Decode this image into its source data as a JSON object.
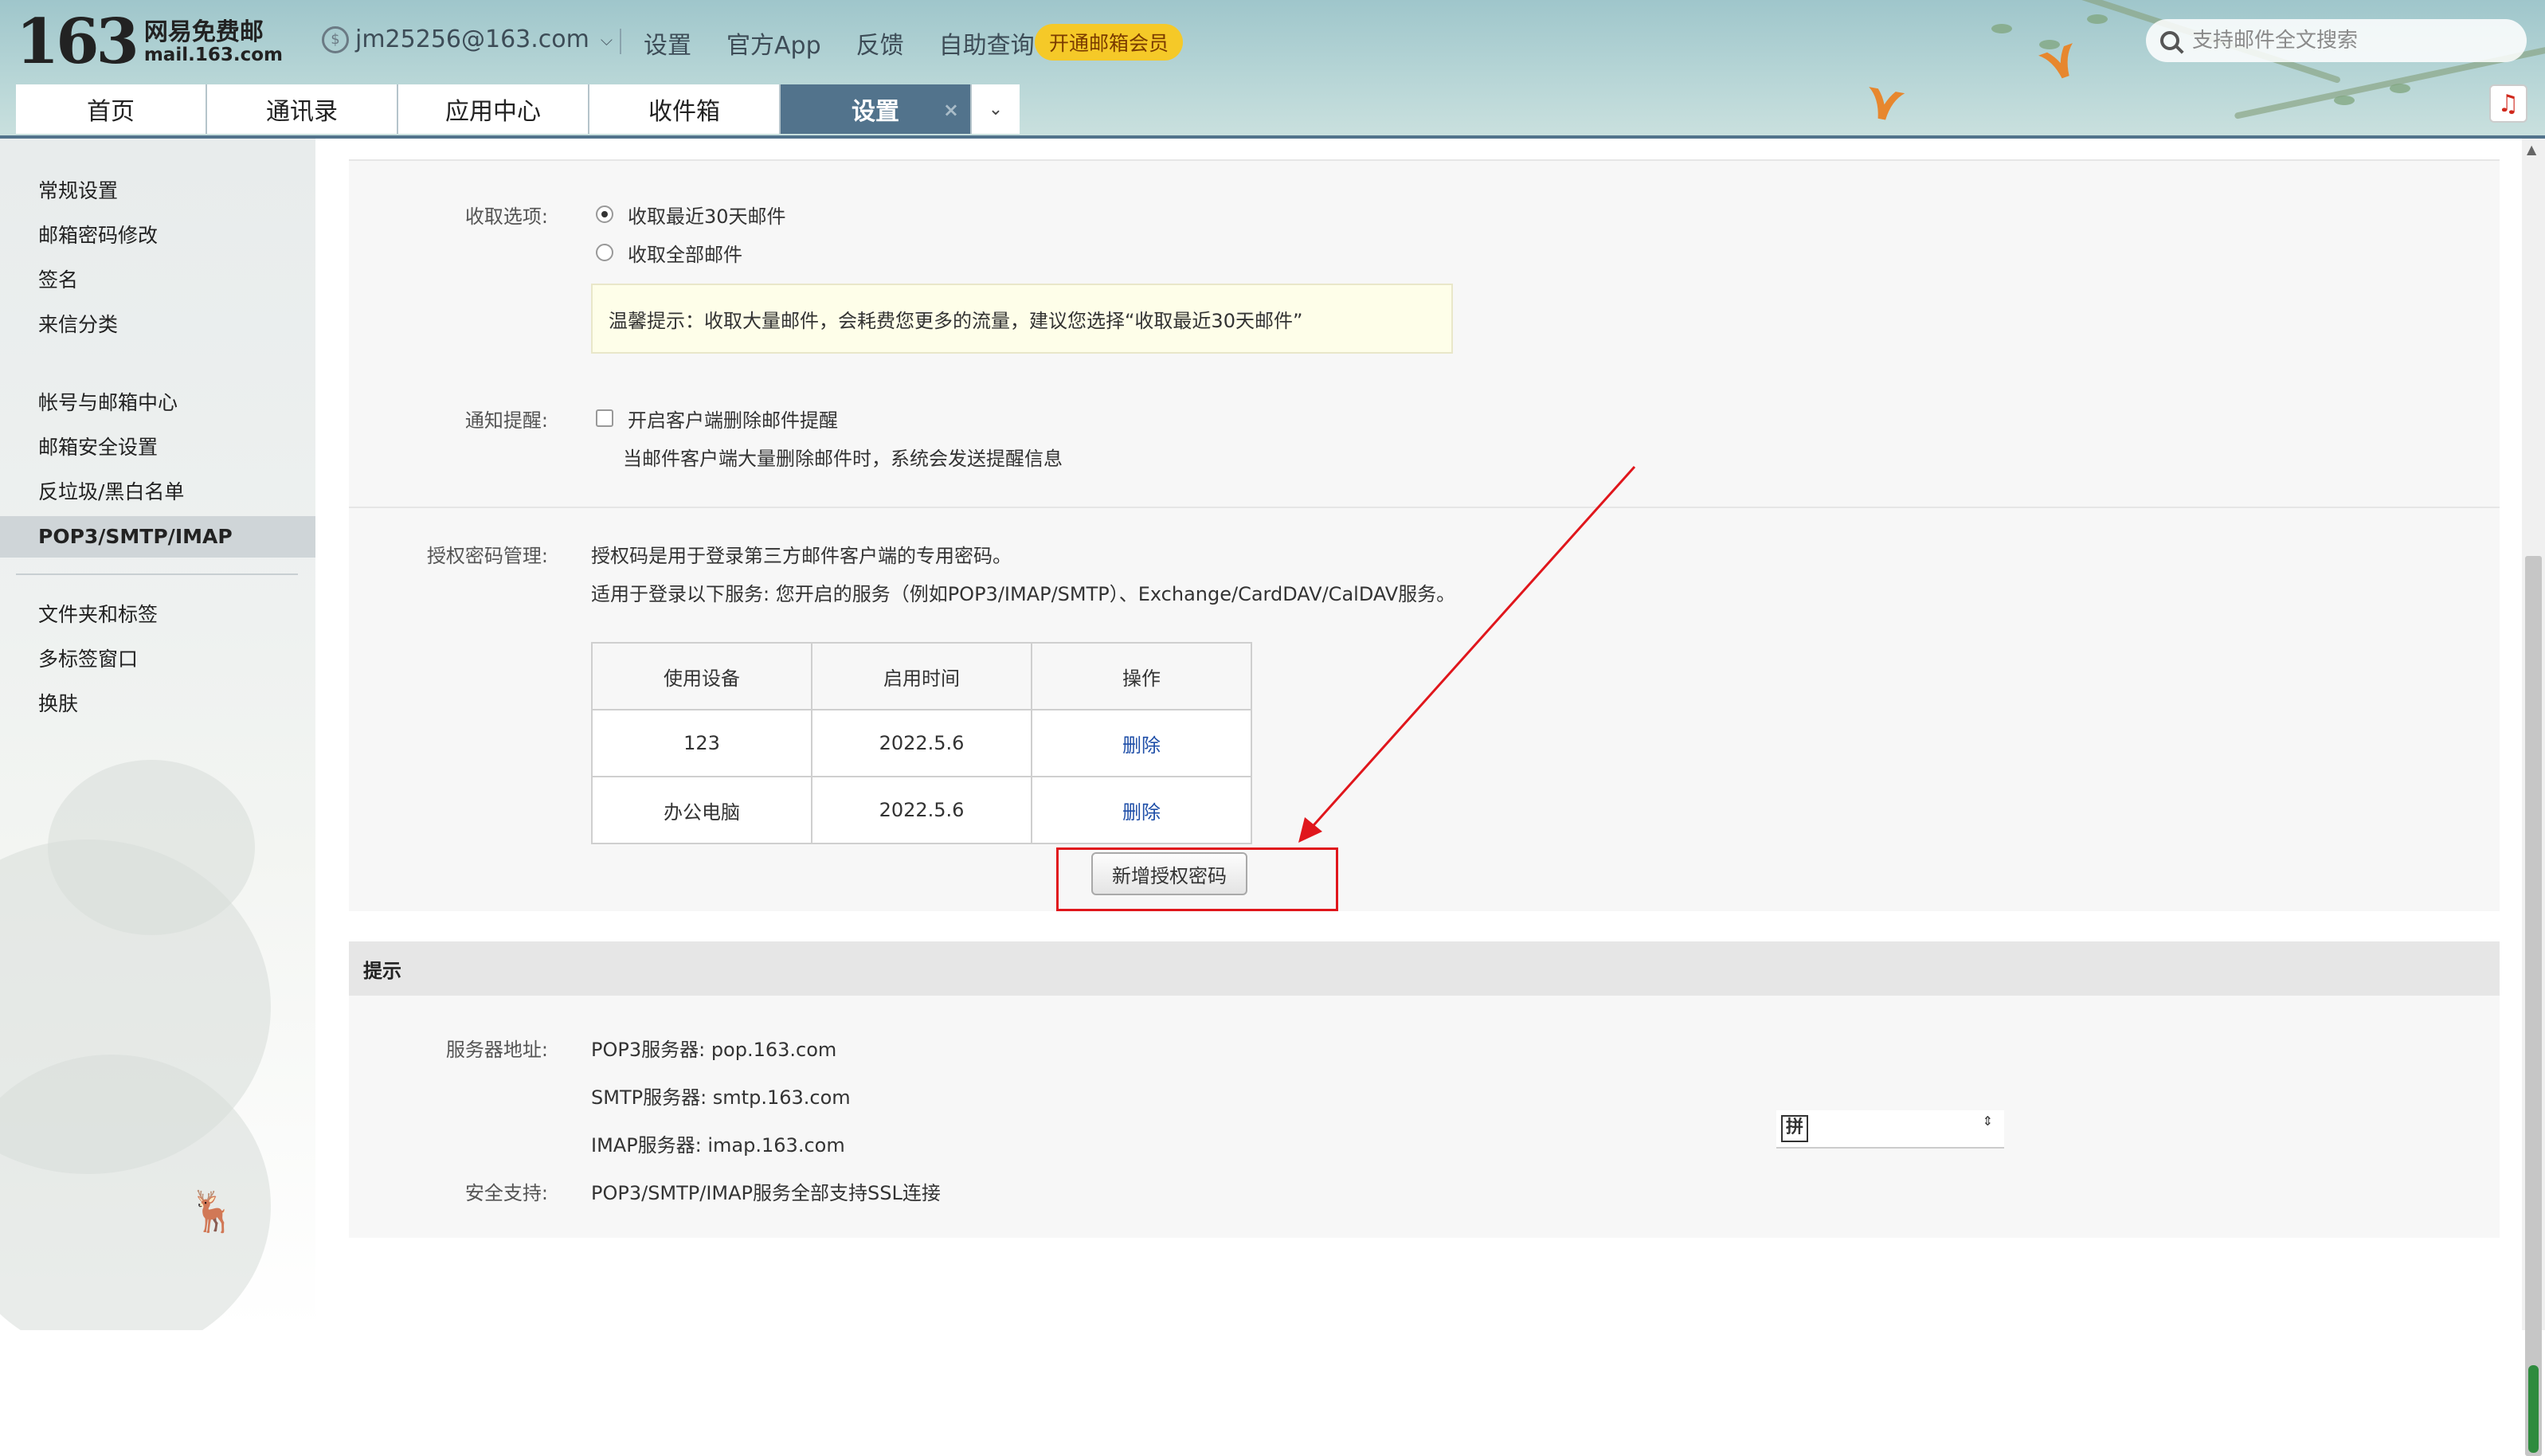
{
  "header": {
    "logo_num": "163",
    "logo_cn": "网易免费邮",
    "logo_en": "mail.163.com",
    "account": "jm25256@163.com",
    "topnav": [
      "设置",
      "官方App",
      "反馈",
      "自助查询"
    ],
    "vip_label": "开通邮箱会员",
    "search_placeholder": "支持邮件全文搜索",
    "tabs": [
      "首页",
      "通讯录",
      "应用中心",
      "收件箱",
      "设置"
    ],
    "active_tab": "设置",
    "close_glyph": "×",
    "more_glyph": "⌄",
    "music_glyph": "♫"
  },
  "sidebar": {
    "group1": [
      "常规设置",
      "邮箱密码修改",
      "签名",
      "来信分类"
    ],
    "group2": [
      "帐号与邮箱中心",
      "邮箱安全设置",
      "反垃圾/黑白名单",
      "POP3/SMTP/IMAP"
    ],
    "group3": [
      "文件夹和标签",
      "多标签窗口",
      "换肤"
    ],
    "active_item": "POP3/SMTP/IMAP"
  },
  "receive": {
    "label": "收取选项:",
    "option_recent": "收取最近30天邮件",
    "option_all": "收取全部邮件",
    "tip": "温馨提示：收取大量邮件，会耗费您更多的流量，建议您选择“收取最近30天邮件”"
  },
  "notify": {
    "label": "通知提醒:",
    "checkbox_label": "开启客户端删除邮件提醒",
    "desc": "当邮件客户端大量删除邮件时，系统会发送提醒信息"
  },
  "auth": {
    "label": "授权密码管理:",
    "line1": "授权码是用于登录第三方邮件客户端的专用密码。",
    "line2": "适用于登录以下服务: 您开启的服务（例如POP3/IMAP/SMTP）、Exchange/CardDAV/CalDAV服务。",
    "columns": [
      "使用设备",
      "启用时间",
      "操作"
    ],
    "rows": [
      {
        "device": "123",
        "date": "2022.5.6",
        "action": "删除"
      },
      {
        "device": "办公电脑",
        "date": "2022.5.6",
        "action": "删除"
      }
    ],
    "new_button": "新增授权密码"
  },
  "tips": {
    "heading": "提示",
    "server_label": "服务器地址:",
    "pop3": "POP3服务器: pop.163.com",
    "smtp": "SMTP服务器: smtp.163.com",
    "imap": "IMAP服务器: imap.163.com",
    "ssl_label": "安全支持:",
    "ssl": "POP3/SMTP/IMAP服务全部支持SSL连接"
  },
  "ime": {
    "key": "拼"
  },
  "colors": {
    "accent": "#52738c",
    "annotation": "#e0161c",
    "link": "#1f4fa8",
    "vip": "#f5c928"
  }
}
